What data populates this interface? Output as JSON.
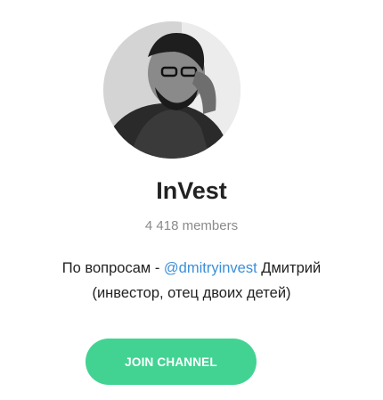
{
  "channel": {
    "avatar_alt": "avatar-photo",
    "title": "InVest",
    "members": "4 418 members",
    "description": {
      "prefix": "По вопросам - ",
      "mention": "@dmitryinvest",
      "suffix": " Дмитрий",
      "line2": "(инвестор, отец двоих детей)"
    },
    "join_label": "JOIN CHANNEL"
  },
  "colors": {
    "button": "#42d392",
    "link": "#3b8fd9",
    "muted": "#8a8a8a"
  }
}
